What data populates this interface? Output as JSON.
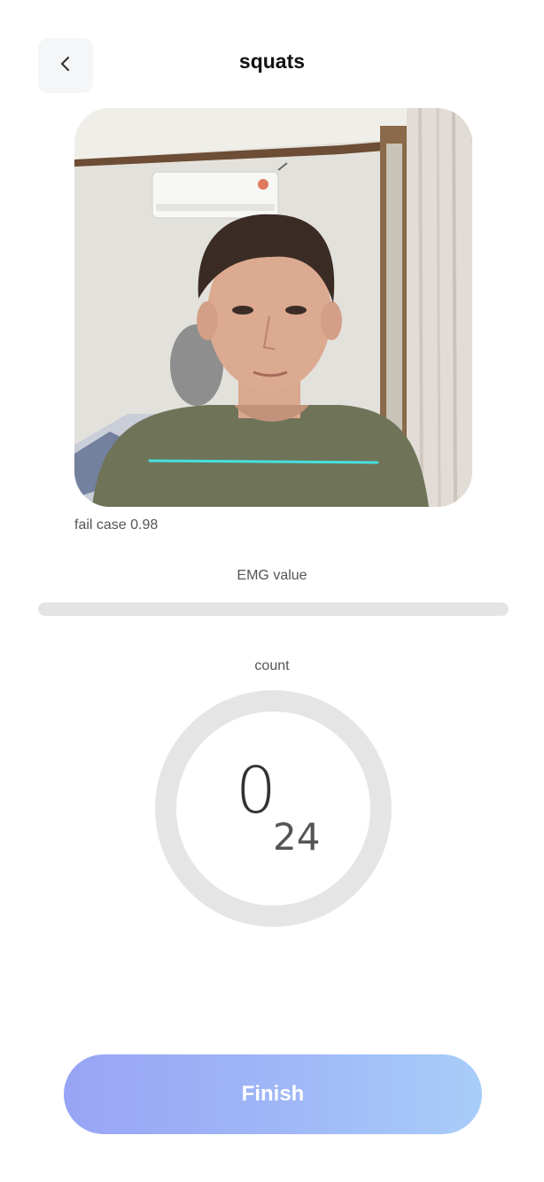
{
  "header": {
    "title": "squats",
    "back_icon": "chevron-left-icon"
  },
  "camera": {
    "status_text": "fail case 0.98",
    "guide_line_color": "#46e0dc"
  },
  "emg": {
    "label": "EMG value",
    "level_percent": 0
  },
  "counter": {
    "label": "count",
    "current": "0",
    "target": "24",
    "progress_fraction": 0
  },
  "footer": {
    "finish_label": "Finish",
    "gradient_start": "#98a4f5",
    "gradient_end": "#a8cdf9"
  }
}
